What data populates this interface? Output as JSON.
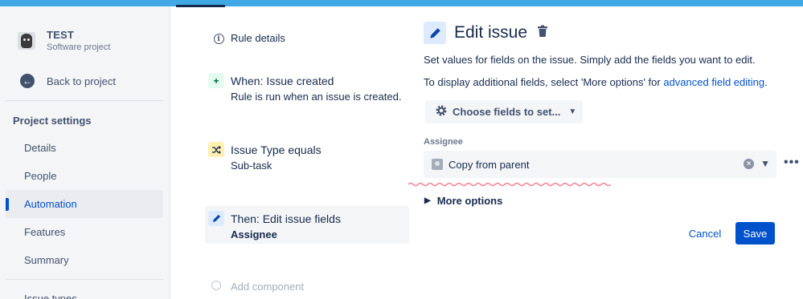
{
  "project": {
    "name": "TEST",
    "type": "Software project"
  },
  "sidebar": {
    "back_label": "Back to project",
    "section_title": "Project settings",
    "items": [
      {
        "label": "Details"
      },
      {
        "label": "People"
      },
      {
        "label": "Automation",
        "active": true
      },
      {
        "label": "Features"
      },
      {
        "label": "Summary"
      },
      {
        "label": "Issue types"
      }
    ]
  },
  "rule": {
    "details_label": "Rule details",
    "trigger": {
      "title": "When: Issue created",
      "subtitle": "Rule is run when an issue is created."
    },
    "condition": {
      "title": "Issue Type equals",
      "subtitle": "Sub-task"
    },
    "action": {
      "title": "Then: Edit issue fields",
      "subtitle": "Assignee"
    },
    "add_component_label": "Add component"
  },
  "edit": {
    "title": "Edit issue",
    "desc1": "Set values for fields on the issue. Simply add the fields you want to edit.",
    "desc2_prefix": "To display additional fields, select 'More options' for ",
    "desc2_link": "advanced field editing",
    "desc2_suffix": ".",
    "choose_fields_label": "Choose fields to set...",
    "assignee_label": "Assignee",
    "assignee_value": "Copy from parent",
    "more_options_label": "More options",
    "cancel_label": "Cancel",
    "save_label": "Save"
  },
  "colors": {
    "accent": "#0052cc",
    "top_bar": "#3fa8e5",
    "sidebar_bg": "#f4f5f7",
    "trigger_icon_bg": "#e3fcef",
    "condition_icon_bg": "#fff0b3",
    "action_icon_bg": "#deebff"
  },
  "icons": {
    "back": "arrow-left-circle-icon",
    "details": "info-icon",
    "trigger": "plus-icon",
    "condition": "shuffle-icon",
    "action": "pencil-icon",
    "delete": "trash-icon",
    "choose_fields": "gear-icon",
    "assignee": "user-avatar-icon"
  }
}
